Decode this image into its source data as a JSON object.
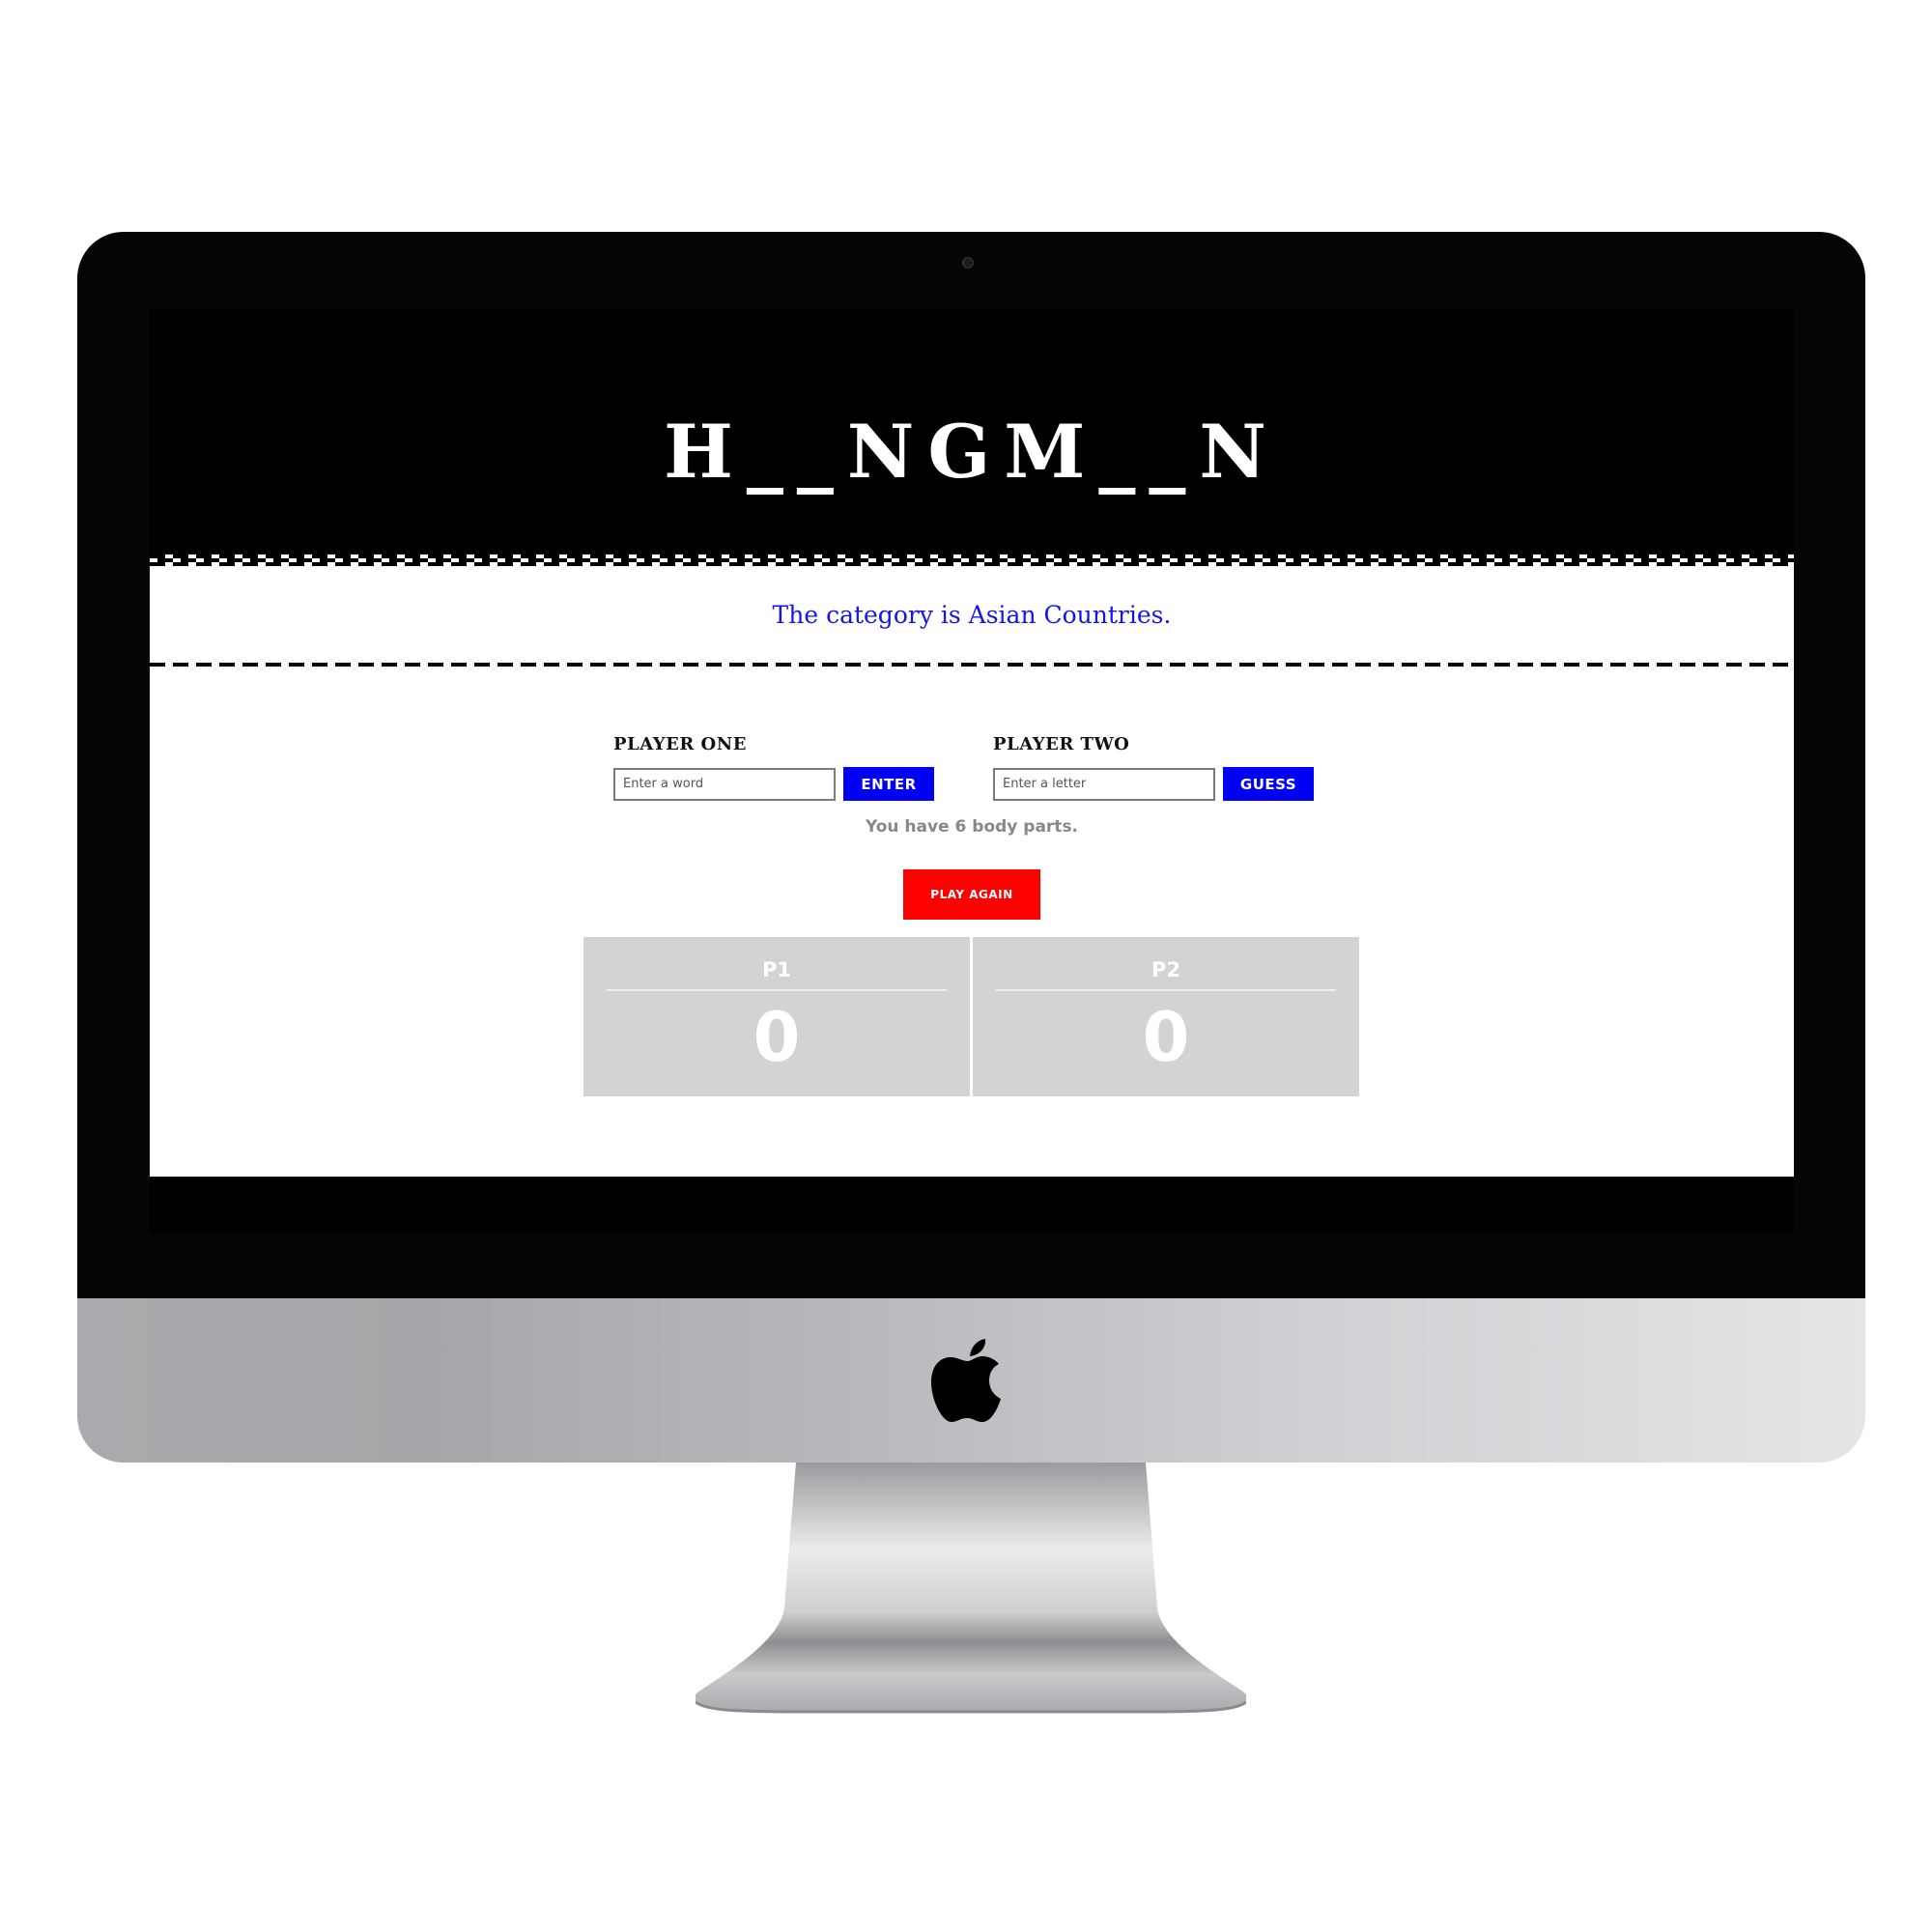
{
  "device": {
    "icons": [
      "apple-logo-icon",
      "camera-icon"
    ]
  },
  "game": {
    "title": "H__NGM__N",
    "category_text": "The category is Asian Countries.",
    "status_text": "You have 6 body parts.",
    "play_again_label": "PLAY AGAIN"
  },
  "player_one": {
    "label": "PLAYER ONE",
    "input_placeholder": "Enter a word",
    "button_label": "ENTER"
  },
  "player_two": {
    "label": "PLAYER TWO",
    "input_placeholder": "Enter a letter",
    "button_label": "GUESS"
  },
  "scoreboard": {
    "p1_label": "P1",
    "p1_score": "0",
    "p2_label": "P2",
    "p2_score": "0"
  },
  "colors": {
    "accent_blue": "#0000f2",
    "category_blue": "#1515e6",
    "play_again_red": "#ff0000",
    "score_card_gray": "#d3d3d3"
  }
}
